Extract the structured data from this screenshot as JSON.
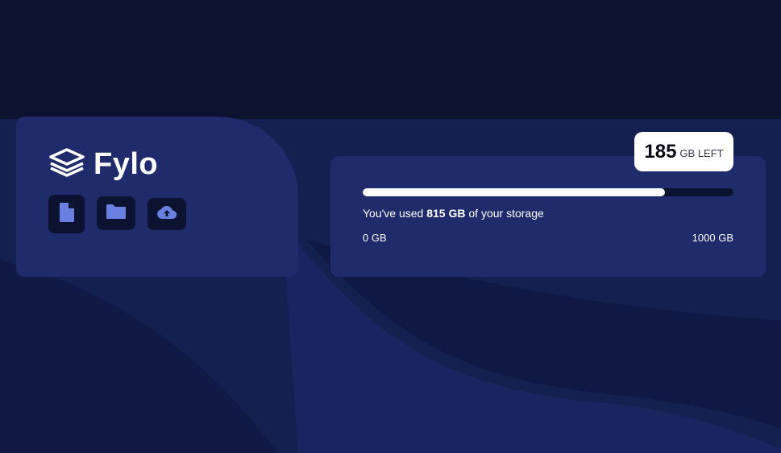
{
  "brand": {
    "name": "Fylo",
    "icon": "stacked-layers-icon"
  },
  "toolbar": {
    "buttons": [
      {
        "icon": "document-icon"
      },
      {
        "icon": "folder-icon"
      },
      {
        "icon": "cloud-upload-icon"
      }
    ]
  },
  "storage": {
    "remaining_number": "185",
    "remaining_unit": "GB LEFT",
    "usage_prefix": "You've used ",
    "usage_amount": "815 GB",
    "usage_suffix": " of your storage",
    "range_min": "0 GB",
    "range_max": "1000 GB",
    "used_fraction": 0.815
  },
  "colors": {
    "page_bg": "#0c1330",
    "card_bg": "#1f2b6b",
    "accent_icon": "#6a7fe0",
    "badge_bg": "#ffffff"
  }
}
